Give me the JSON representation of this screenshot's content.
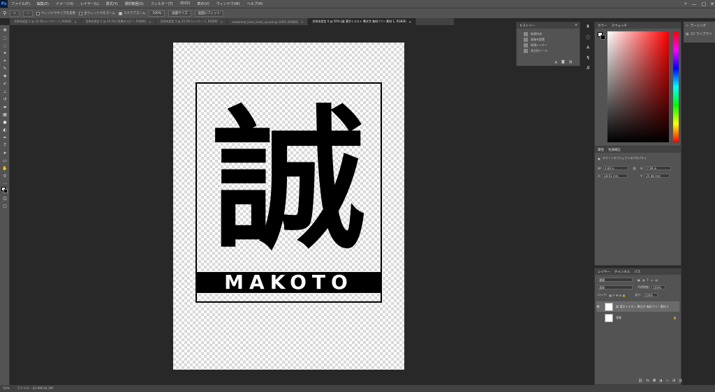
{
  "menu": {
    "items": [
      "ファイル(F)",
      "編集(E)",
      "イメージ(I)",
      "レイヤー(L)",
      "書式(Y)",
      "選択範囲(S)",
      "フィルター(T)",
      "3D(D)",
      "表示(V)",
      "ウィンドウ(W)",
      "ヘルプ(H)"
    ],
    "minimize": "—",
    "maximize": "□",
    "close": "✕"
  },
  "options": {
    "zoom_in": "+",
    "zoom_out": "−",
    "resize_windows": "ウィンドウサイズを変更",
    "zoom_all": "全ウィンドウをズーム",
    "scrubby_zoom": "スクラブズーム",
    "zoom_level": "100%",
    "fit_screen": "画面サイズ",
    "fill_screen": "画面にフィット"
  },
  "tabs": [
    {
      "label": "名称未設定 1 @ 33.3% (レイヤー 1, RGB/8)",
      "active": false
    },
    {
      "label": "名称未設定 2 @ 33.3% (背景のコピー, RGB/8)",
      "active": false
    },
    {
      "label": "名称未設定 3 @ 33.3% (レイヤー 1, RGB/8)",
      "active": false
    },
    {
      "label": "mohamad_hose_mock_up.psd @ 100% (RGB/8)",
      "active": false
    },
    {
      "label": "名称未設定 4 @ 50% (誠 漢字イラスト 筆文字 無料フリー素材 1, RGB/8)",
      "active": true
    }
  ],
  "document": {
    "kanji": "誠",
    "name": "MAKOTO"
  },
  "status": {
    "zoom": "50%",
    "file_info": "ファイル : 24.9M/16.3M"
  },
  "history": {
    "tabs": [
      "ヒストリー"
    ],
    "items": [
      "新規作成",
      "画像を配置",
      "新規レイヤー",
      "長方形ツール"
    ]
  },
  "color": {
    "tabs": [
      "カラー",
      "スウォッチ"
    ],
    "picker_hue": "#ff0000"
  },
  "properties": {
    "tabs": [
      "属性",
      "色調補正"
    ],
    "kind": "スマートオブジェクトのプロパティ",
    "w_label": "W:",
    "w_value": "4.80 in",
    "h_label": "H:",
    "h_value": "7.99 in",
    "x_label": "X:",
    "x_value": "28.91 mm",
    "y_label": "Y:",
    "y_value": "25.48 mm"
  },
  "layers": {
    "tabs": [
      "レイヤー",
      "チャンネル",
      "パス"
    ],
    "filter": "種類",
    "blend": "通常",
    "opacity_label": "不透明度:",
    "opacity": "100%",
    "lock_label": "ロック:",
    "fill_label": "塗り:",
    "fill": "100%",
    "items": [
      {
        "name": "誠 漢字イラスト 筆文字 無料フリー素材 1",
        "selected": true
      },
      {
        "name": "背景",
        "selected": false
      }
    ]
  },
  "far_panel": {
    "items": [
      "ラーニング",
      "CC ライブラリ"
    ]
  }
}
